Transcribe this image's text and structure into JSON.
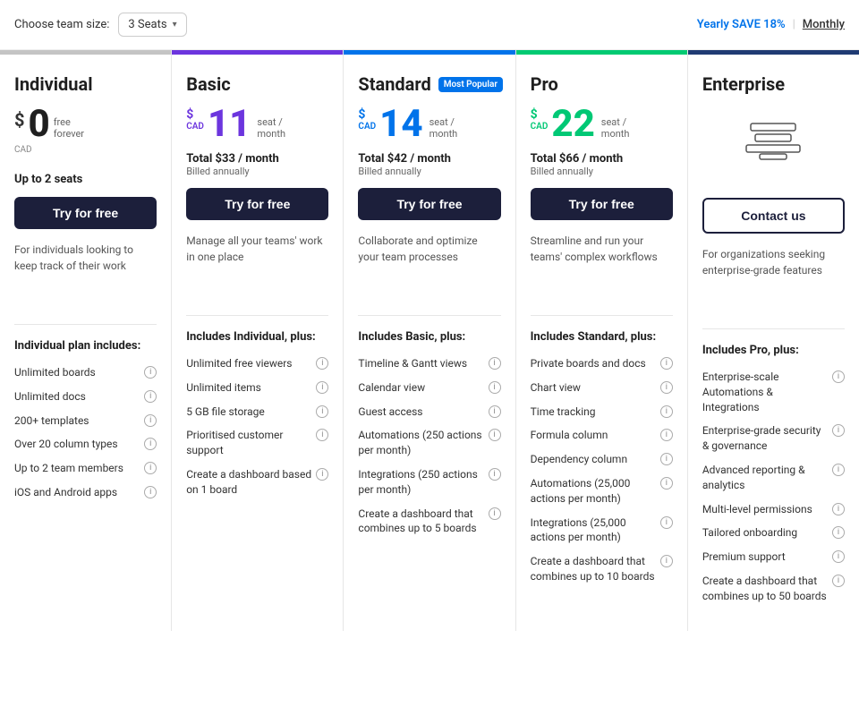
{
  "topBar": {
    "label": "Choose team size:",
    "seatSelect": "3 Seats",
    "yearlyLabel": "Yearly SAVE 18%",
    "divider": "|",
    "monthlyLabel": "Monthly"
  },
  "plans": [
    {
      "id": "individual",
      "name": "Individual",
      "colorClass": "plan-individual",
      "priceClass": "price-individual",
      "currencySymbol": "$",
      "currencyCode": "CAD",
      "amount": "0",
      "freeLabel": "free\nforever",
      "perUnit": "",
      "total": "",
      "billedNote": "",
      "seatsNote": "Up to 2 seats",
      "ctaLabel": "Try for free",
      "ctaClass": "cta-dark",
      "desc": "For individuals looking to keep track of their work",
      "mostPopular": false,
      "includesTitle": "Individual plan includes:",
      "features": [
        "Unlimited boards",
        "Unlimited docs",
        "200+ templates",
        "Over 20 column types",
        "Up to 2 team members",
        "iOS and Android apps"
      ]
    },
    {
      "id": "basic",
      "name": "Basic",
      "colorClass": "plan-basic",
      "priceClass": "price-basic",
      "currencySymbol": "$",
      "currencyCode": "CAD",
      "amount": "11",
      "perUnit": "seat /\nmonth",
      "total": "Total $33 / month",
      "billedNote": "Billed annually",
      "seatsNote": "",
      "ctaLabel": "Try for free",
      "ctaClass": "cta-dark",
      "desc": "Manage all your teams' work in one place",
      "mostPopular": false,
      "includesTitle": "Includes Individual, plus:",
      "features": [
        "Unlimited free viewers",
        "Unlimited items",
        "5 GB file storage",
        "Prioritised customer support",
        "Create a dashboard based on 1 board"
      ]
    },
    {
      "id": "standard",
      "name": "Standard",
      "colorClass": "plan-standard",
      "priceClass": "price-standard",
      "currencySymbol": "$",
      "currencyCode": "CAD",
      "amount": "14",
      "perUnit": "seat /\nmonth",
      "total": "Total $42 / month",
      "billedNote": "Billed annually",
      "seatsNote": "",
      "ctaLabel": "Try for free",
      "ctaClass": "cta-dark",
      "desc": "Collaborate and optimize your team processes",
      "mostPopular": true,
      "includesTitle": "Includes Basic, plus:",
      "features": [
        "Timeline & Gantt views",
        "Calendar view",
        "Guest access",
        "Automations (250 actions per month)",
        "Integrations (250 actions per month)",
        "Create a dashboard that combines up to 5 boards"
      ]
    },
    {
      "id": "pro",
      "name": "Pro",
      "colorClass": "plan-pro",
      "priceClass": "price-pro",
      "currencySymbol": "$",
      "currencyCode": "CAD",
      "amount": "22",
      "perUnit": "seat /\nmonth",
      "total": "Total $66 / month",
      "billedNote": "Billed annually",
      "seatsNote": "",
      "ctaLabel": "Try for free",
      "ctaClass": "cta-dark",
      "desc": "Streamline and run your teams' complex workflows",
      "mostPopular": false,
      "includesTitle": "Includes Standard, plus:",
      "features": [
        "Private boards and docs",
        "Chart view",
        "Time tracking",
        "Formula column",
        "Dependency column",
        "Automations (25,000 actions per month)",
        "Integrations (25,000 actions per month)",
        "Create a dashboard that combines up to 10 boards"
      ]
    },
    {
      "id": "enterprise",
      "name": "Enterprise",
      "colorClass": "plan-enterprise",
      "priceClass": "",
      "currencySymbol": "",
      "currencyCode": "",
      "amount": "",
      "perUnit": "",
      "total": "",
      "billedNote": "",
      "seatsNote": "",
      "ctaLabel": "Contact us",
      "ctaClass": "cta-outline",
      "desc": "For organizations seeking enterprise-grade features",
      "mostPopular": false,
      "includesTitle": "Includes Pro, plus:",
      "features": [
        "Enterprise-scale Automations & Integrations",
        "Enterprise-grade security & governance",
        "Advanced reporting & analytics",
        "Multi-level permissions",
        "Tailored onboarding",
        "Premium support",
        "Create a dashboard that combines up to 50 boards"
      ]
    }
  ]
}
